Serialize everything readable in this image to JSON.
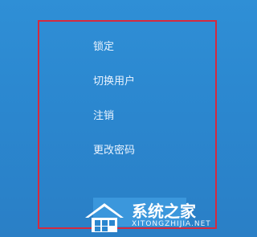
{
  "menu": {
    "items": [
      {
        "label": "锁定"
      },
      {
        "label": "切换用户"
      },
      {
        "label": "注销"
      },
      {
        "label": "更改密码"
      }
    ]
  },
  "watermark": {
    "title": "系统之家",
    "subtitle": "XITONGZHIJIA.NET",
    "icon": "house-logo-icon"
  },
  "colors": {
    "background": "#2b87cf",
    "highlight_border": "#d42a3f",
    "menu_text": "#eaf4ff"
  }
}
